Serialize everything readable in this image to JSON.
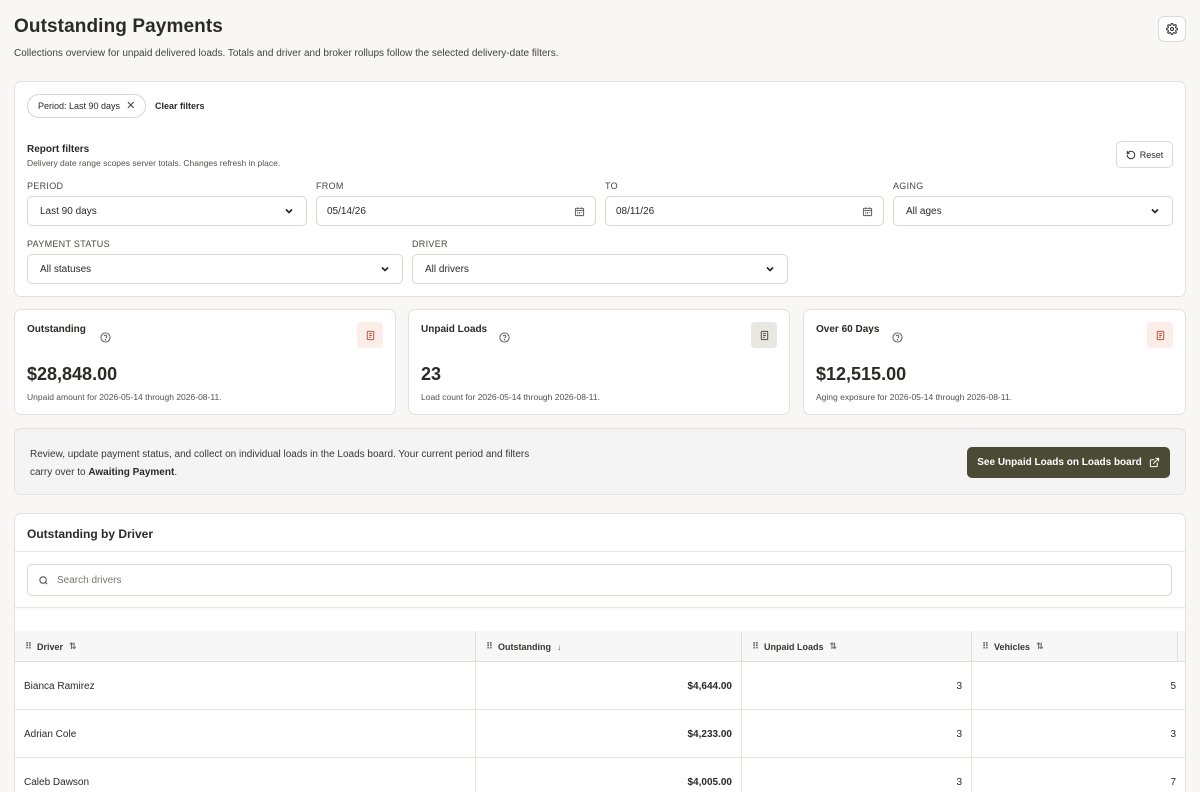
{
  "header": {
    "title": "Outstanding Payments",
    "subtitle": "Collections overview for unpaid delivered loads. Totals and driver and broker rollups follow the selected delivery-date filters."
  },
  "filters": {
    "active_chip": "Period: Last 90 days",
    "clear_label": "Clear filters",
    "title": "Report filters",
    "description": "Delivery date range scopes server totals. Changes refresh in place.",
    "reset_label": "Reset",
    "period": {
      "label": "PERIOD",
      "value": "Last 90 days"
    },
    "from": {
      "label": "FROM",
      "value": "05/14/26"
    },
    "to": {
      "label": "TO",
      "value": "08/11/26"
    },
    "aging": {
      "label": "AGING",
      "value": "All ages"
    },
    "payment_status": {
      "label": "PAYMENT STATUS",
      "value": "All statuses"
    },
    "driver": {
      "label": "DRIVER",
      "value": "All drivers"
    }
  },
  "kpis": [
    {
      "label": "Outstanding",
      "value": "$28,848.00",
      "note": "Unpaid amount for 2026-05-14 through 2026-08-11.",
      "icon_bg": "#fbeee8",
      "icon_color": "#c0563a"
    },
    {
      "label": "Unpaid Loads",
      "value": "23",
      "note": "Load count for 2026-05-14 through 2026-08-11.",
      "icon_bg": "#e9e7e2",
      "icon_color": "#555049"
    },
    {
      "label": "Over 60 Days",
      "value": "$12,515.00",
      "note": "Aging exposure for 2026-05-14 through 2026-08-11.",
      "icon_bg": "#fbeee8",
      "icon_color": "#c0563a"
    }
  ],
  "promo": {
    "text_1": "Review, update payment status, and collect on individual loads in the Loads board. Your current period and filters carry over to ",
    "text_bold": "Awaiting Payment",
    "text_end": ".",
    "button_label": "See Unpaid Loads on Loads board"
  },
  "drivers": {
    "title": "Outstanding by Driver",
    "search_placeholder": "Search drivers",
    "columns": {
      "driver": "Driver",
      "outstanding": "Outstanding",
      "unpaid_loads": "Unpaid Loads",
      "vehicles": "Vehicles"
    },
    "rows": [
      {
        "name": "Bianca Ramirez",
        "outstanding": "$4,644.00",
        "unpaid_loads": "3",
        "vehicles": "5"
      },
      {
        "name": "Adrian Cole",
        "outstanding": "$4,233.00",
        "unpaid_loads": "3",
        "vehicles": "3"
      },
      {
        "name": "Caleb Dawson",
        "outstanding": "$4,005.00",
        "unpaid_loads": "3",
        "vehicles": "7"
      }
    ]
  },
  "icons": {
    "settings": "gear-icon",
    "chip_close": "close-icon",
    "reset": "rotate-ccw-icon",
    "calendar": "calendar-icon",
    "select": "chevron-down-icon",
    "help": "help-circle-icon",
    "kpi": "receipt-icon",
    "external": "external-link-icon",
    "search": "search-icon",
    "drag": "grip-icon",
    "sort_both": "sort-arrows-icon",
    "sort_desc": "arrow-down-icon"
  }
}
